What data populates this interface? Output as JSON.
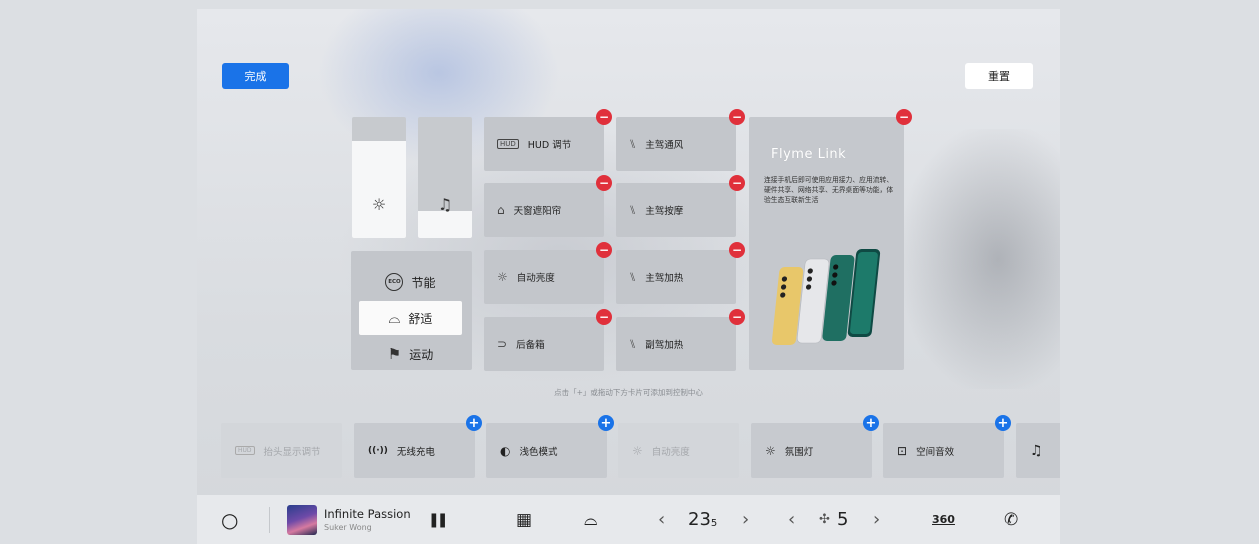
{
  "header": {
    "done_label": "完成",
    "reset_label": "重置"
  },
  "sliders": [
    {
      "icon": "brightness-icon",
      "glyph": "☼",
      "level": 0.8
    },
    {
      "icon": "music-note-icon",
      "glyph": "♫",
      "level": 0.22
    }
  ],
  "drive_modes": [
    {
      "label": "节能",
      "icon": "eco-icon",
      "glyph": "ECO",
      "selected": false
    },
    {
      "label": "舒适",
      "icon": "comfort-car-icon",
      "glyph": "⌓",
      "selected": true
    },
    {
      "label": "运动",
      "icon": "sport-flag-icon",
      "glyph": "⚑",
      "selected": false
    }
  ],
  "tiles": [
    {
      "label": "HUD 调节",
      "icon": "hud-icon",
      "glyph": "▭"
    },
    {
      "label": "主驾通风",
      "icon": "seat-ventilation-icon",
      "glyph": "⑊"
    },
    {
      "label": "天窗遮阳帘",
      "icon": "sunroof-shade-icon",
      "glyph": "⌂"
    },
    {
      "label": "主驾按摩",
      "icon": "seat-massage-icon",
      "glyph": "⑊"
    },
    {
      "label": "自动亮度",
      "icon": "auto-brightness-icon",
      "glyph": "☼"
    },
    {
      "label": "主驾加热",
      "icon": "seat-heating-icon",
      "glyph": "⑊"
    },
    {
      "label": "后备箱",
      "icon": "trunk-icon",
      "glyph": "⊃"
    },
    {
      "label": "副驾加热",
      "icon": "passenger-seat-heating-icon",
      "glyph": "⑊"
    }
  ],
  "flyme": {
    "title": "Flyme Link",
    "description": "连接手机后即可使用应用接力、应用流转、硬件共享、网络共享、无界桌面等功能，体验生态互联新生活"
  },
  "hint": "点击「+」或拖动下方卡片可添加到控制中心",
  "available_cards": [
    {
      "label": "抬头显示调节",
      "icon": "hud-icon",
      "glyph": "▭",
      "enabled": false,
      "addable": false
    },
    {
      "label": "无线充电",
      "icon": "wireless-charging-icon",
      "glyph": "((·))",
      "enabled": true,
      "addable": true
    },
    {
      "label": "浅色模式",
      "icon": "light-mode-icon",
      "glyph": "◐",
      "enabled": true,
      "addable": true
    },
    {
      "label": "自动亮度",
      "icon": "auto-brightness-icon",
      "glyph": "☼",
      "enabled": false,
      "addable": false
    },
    {
      "label": "氛围灯",
      "icon": "ambient-light-icon",
      "glyph": "☼",
      "enabled": true,
      "addable": true
    },
    {
      "label": "空间音效",
      "icon": "spatial-audio-icon",
      "glyph": "⊡",
      "enabled": true,
      "addable": true
    },
    {
      "label": "",
      "icon": "music-note-icon",
      "glyph": "♫",
      "enabled": true,
      "addable": false
    }
  ],
  "bottom_bar": {
    "home_glyph": "○",
    "song_title": "Infinite Passion",
    "artist": "Suker Wong",
    "pause_glyph": "❚❚",
    "apps_glyph": "▦",
    "car_glyph": "⌓",
    "temp_left": "‹",
    "temperature": "23",
    "temperature_decimal": "5",
    "temp_right": "›",
    "fan_left": "‹",
    "fan_glyph": "✣",
    "fan_level": "5",
    "fan_right": "›",
    "view_360": "360",
    "phone_glyph": "✆"
  }
}
